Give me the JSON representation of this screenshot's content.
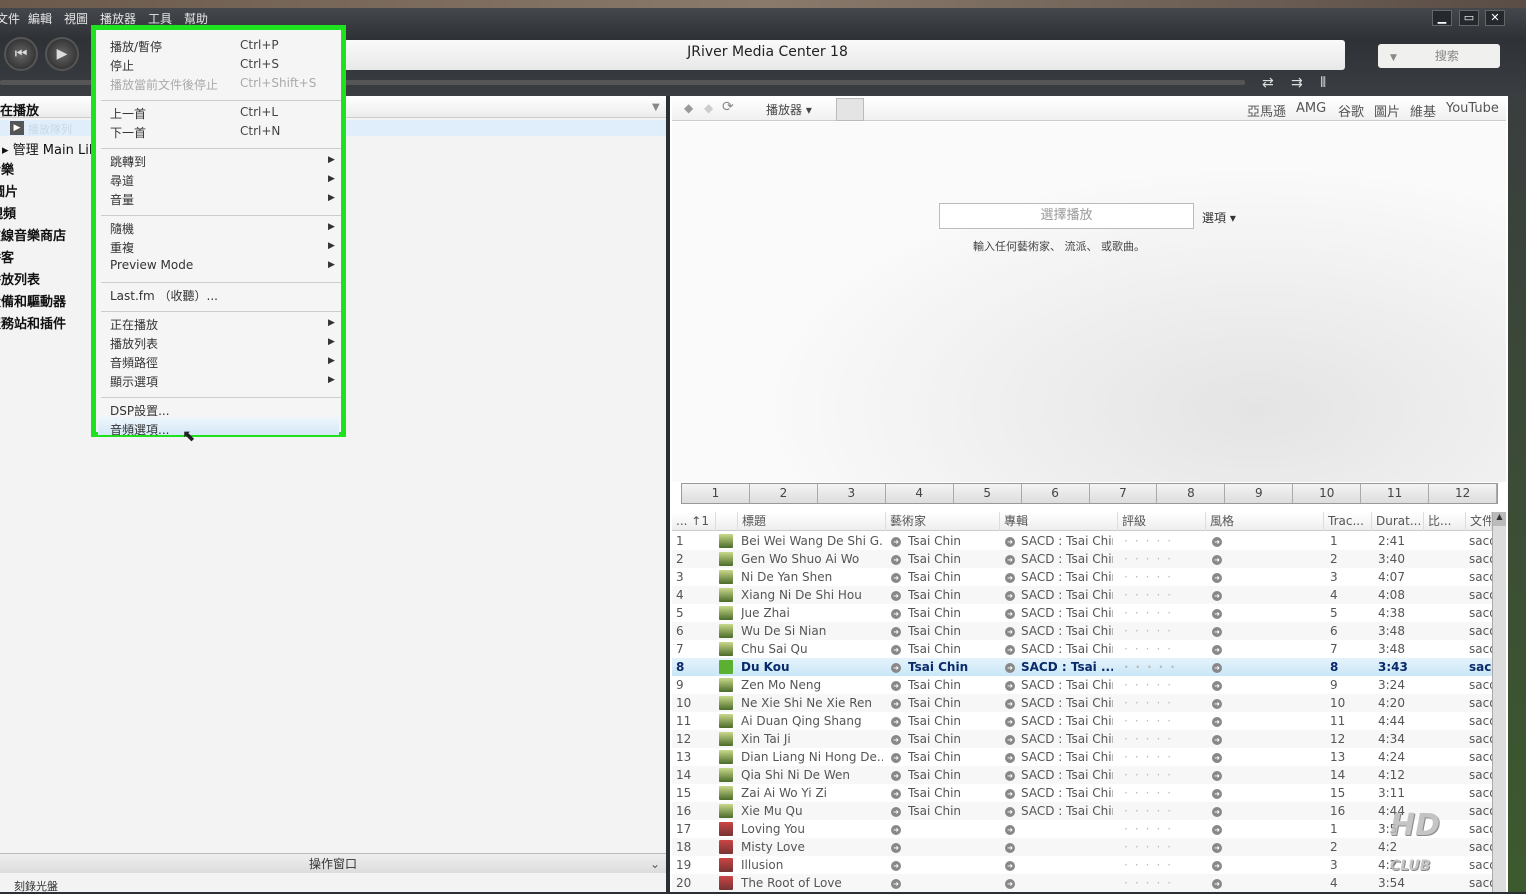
{
  "menubar": [
    "文件",
    "編輯",
    "視圖",
    "播放器",
    "工具",
    "幫助"
  ],
  "window": {
    "title": "JRiver Media Center 18",
    "search_label": "搜索",
    "min": "▁",
    "max": "▭",
    "close": "✕"
  },
  "sidebar": {
    "items": [
      "正在播放",
      "播放隊列",
      "管理 Main Library",
      "音樂",
      "圖片",
      "視頻",
      "在線音樂商店",
      "播客",
      "播放列表",
      "設備和驅動器",
      "服務站和插件"
    ],
    "action_window": "操作窗口",
    "burn": "刻錄光盤"
  },
  "browser": {
    "player_label": "播放器 ▾",
    "links": [
      "亞馬遜",
      "AMG",
      "谷歌",
      "圖片",
      "維基",
      "YouTube"
    ],
    "play_select_placeholder": "選擇播放",
    "options_label": "選項 ▾",
    "hint": "輸入任何藝術家、 流派、 或歌曲。"
  },
  "tabs": [
    "1",
    "2",
    "3",
    "4",
    "5",
    "6",
    "7",
    "8",
    "9",
    "10",
    "11",
    "12"
  ],
  "table": {
    "headers": [
      "... ↑1",
      "標題",
      "藝術家",
      "專輯",
      "評級",
      "風格",
      "Trac...",
      "Durat...",
      "比...",
      "文件"
    ],
    "rows": [
      [
        "1",
        "Bei Wei Wang De Shi G...",
        "Tsai Chin",
        "SACD : Tsai Chin",
        "1",
        "2:41",
        "sacd"
      ],
      [
        "2",
        "Gen Wo Shuo Ai Wo",
        "Tsai Chin",
        "SACD : Tsai Chin",
        "2",
        "3:40",
        "sacd"
      ],
      [
        "3",
        "Ni De Yan Shen",
        "Tsai Chin",
        "SACD : Tsai Chin",
        "3",
        "4:07",
        "sacd"
      ],
      [
        "4",
        "Xiang Ni De Shi Hou",
        "Tsai Chin",
        "SACD : Tsai Chin",
        "4",
        "4:08",
        "sacd"
      ],
      [
        "5",
        "Jue Zhai",
        "Tsai Chin",
        "SACD : Tsai Chin",
        "5",
        "4:38",
        "sacd"
      ],
      [
        "6",
        "Wu De Si Nian",
        "Tsai Chin",
        "SACD : Tsai Chin",
        "6",
        "3:48",
        "sacd"
      ],
      [
        "7",
        "Chu Sai Qu",
        "Tsai Chin",
        "SACD : Tsai Chin",
        "7",
        "3:48",
        "sacd"
      ],
      [
        "8",
        "Du Kou",
        "Tsai Chin",
        "SACD : Tsai ...",
        "8",
        "3:43",
        "sacd"
      ],
      [
        "9",
        "Zen Mo Neng",
        "Tsai Chin",
        "SACD : Tsai Chin",
        "9",
        "3:24",
        "sacd"
      ],
      [
        "10",
        "Ne Xie Shi Ne Xie Ren",
        "Tsai Chin",
        "SACD : Tsai Chin",
        "10",
        "4:20",
        "sacd"
      ],
      [
        "11",
        "Ai Duan Qing Shang",
        "Tsai Chin",
        "SACD : Tsai Chin",
        "11",
        "4:44",
        "sacd"
      ],
      [
        "12",
        "Xin Tai Ji",
        "Tsai Chin",
        "SACD : Tsai Chin",
        "12",
        "4:34",
        "sacd"
      ],
      [
        "13",
        "Dian Liang Ni Hong De...",
        "Tsai Chin",
        "SACD : Tsai Chin",
        "13",
        "4:24",
        "sacd"
      ],
      [
        "14",
        "Qia Shi Ni De Wen",
        "Tsai Chin",
        "SACD : Tsai Chin",
        "14",
        "4:12",
        "sacd"
      ],
      [
        "15",
        "Zai Ai Wo Yi Zi",
        "Tsai Chin",
        "SACD : Tsai Chin",
        "15",
        "3:11",
        "sacd"
      ],
      [
        "16",
        "Xie Mu Qu",
        "Tsai Chin",
        "SACD : Tsai Chin",
        "16",
        "4:44",
        "sacd"
      ],
      [
        "17",
        "Loving You",
        "",
        "",
        "1",
        "3:5",
        "sacd"
      ],
      [
        "18",
        "Misty Love",
        "",
        "",
        "2",
        "4:2",
        "sacd"
      ],
      [
        "19",
        "Illusion",
        "",
        "",
        "3",
        "4:2",
        "sacd"
      ],
      [
        "20",
        "The Root of Love",
        "",
        "",
        "4",
        "3:54",
        "sacd"
      ]
    ],
    "current_row": "8"
  },
  "context_menu": {
    "items": [
      {
        "label": "播放/暫停",
        "shortcut": "Ctrl+P"
      },
      {
        "label": "停止",
        "shortcut": "Ctrl+S"
      },
      {
        "label": "播放當前文件後停止",
        "shortcut": "Ctrl+Shift+S",
        "disabled": true
      },
      {
        "label": "上一首",
        "shortcut": "Ctrl+L"
      },
      {
        "label": "下一首",
        "shortcut": "Ctrl+N"
      },
      {
        "label": "跳轉到",
        "sub": true
      },
      {
        "label": "尋道",
        "sub": true
      },
      {
        "label": "音量",
        "sub": true
      },
      {
        "label": "隨機",
        "sub": true
      },
      {
        "label": "重複",
        "sub": true
      },
      {
        "label": "Preview Mode",
        "sub": true
      },
      {
        "label": "Last.fm （收聽）..."
      },
      {
        "label": "正在播放",
        "sub": true
      },
      {
        "label": "播放列表",
        "sub": true
      },
      {
        "label": "音頻路徑",
        "sub": true
      },
      {
        "label": "顯示選項",
        "sub": true
      },
      {
        "label": "DSP設置..."
      },
      {
        "label": "音頻選項..."
      }
    ]
  },
  "watermark": "HD CLUB",
  "colors": {
    "highlight": "#1de21d",
    "current_row": "#c9e7f7"
  }
}
